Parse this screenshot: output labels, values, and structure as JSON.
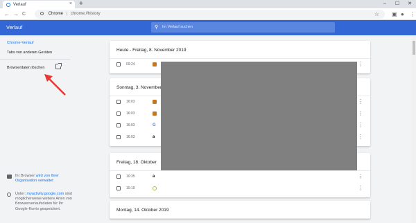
{
  "tab": {
    "title": "Verlauf",
    "close": "×",
    "new_tab": "+"
  },
  "window_controls": [
    "–",
    "☐",
    "✕"
  ],
  "toolbar": {
    "back": "←",
    "forward": "→",
    "reload": "C",
    "site_label": "Chrome",
    "separator": "|",
    "url": "chrome://history",
    "star": "☆",
    "ext1": "▣",
    "ext2": "●",
    "menu": "⋮"
  },
  "header": {
    "title": "Verlauf",
    "search_placeholder": "Im Verlauf suchen"
  },
  "sidebar": {
    "items": [
      "Chrome-Verlauf",
      "Tabs von anderen Geräten",
      "Browserdaten löschen"
    ],
    "managed_prefix": "Ihr Browser ",
    "managed_link": "wird von Ihrer Organisation verwaltet",
    "note_prefix": "Unter: ",
    "note_link": "myactivity.google.com",
    "note_suffix": " sind möglicherweise weitere Arten von Browserverlaufsdaten für Ihr Google-Konto gespeichert."
  },
  "history": [
    {
      "day": "Heute - Freitag, 8. November 2019",
      "rows": [
        {
          "time": "09:24",
          "icon": "briefcase",
          "color": "#c5761e"
        }
      ]
    },
    {
      "day": "Sonntag, 3. November",
      "rows": [
        {
          "time": "16:03",
          "icon": "briefcase",
          "color": "#c5761e"
        },
        {
          "time": "16:03",
          "icon": "briefcase",
          "color": "#c5761e"
        },
        {
          "time": "16:03",
          "icon": "google-g",
          "color": "#4285f4"
        },
        {
          "time": "16:03",
          "icon": "amazon-a",
          "color": "#111111"
        }
      ]
    },
    {
      "day": "Freitag, 18. Oktober",
      "rows": [
        {
          "time": "10:35",
          "icon": "amazon-a",
          "color": "#111111"
        },
        {
          "time": "10:19",
          "icon": "circle",
          "color": "#a8c23a"
        }
      ]
    },
    {
      "day": "Montag, 14. Oktober 2019",
      "rows": []
    }
  ],
  "row_menu": "⋮",
  "favicon_glyphs": {
    "amazon-a": "a",
    "google-g": "G"
  },
  "colors": {
    "header": "#3367d6",
    "accent": "#1a73e8",
    "arrow": "#e53935"
  }
}
